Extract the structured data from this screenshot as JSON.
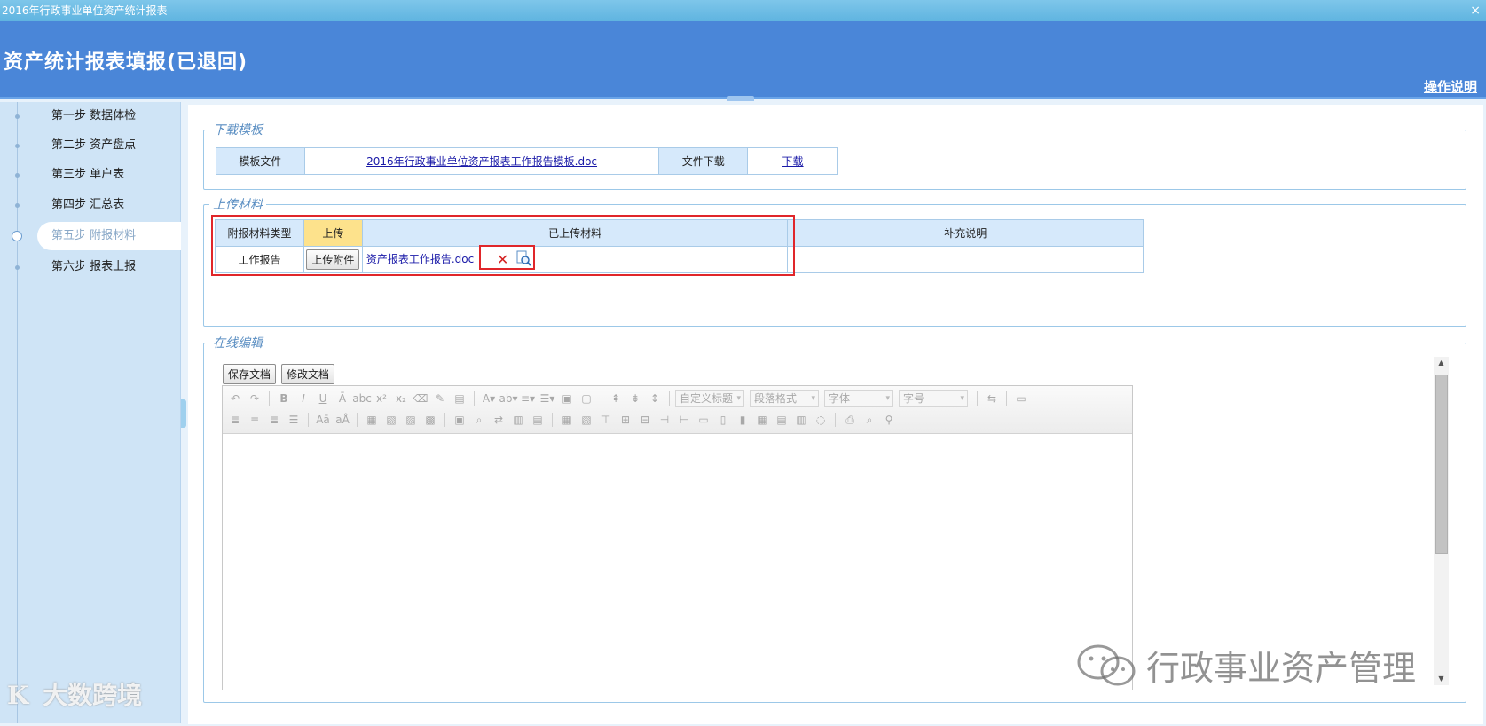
{
  "window": {
    "title": "2016年行政事业单位资产统计报表",
    "close_glyph": "×"
  },
  "header": {
    "title": "资产统计报表填报(已退回)",
    "help": "操作说明"
  },
  "sidebar": {
    "steps": [
      {
        "label": "第一步 数据体检"
      },
      {
        "label": "第二步 资产盘点"
      },
      {
        "label": "第三步 单户表"
      },
      {
        "label": "第四步 汇总表"
      },
      {
        "label": "第五步 附报材料"
      },
      {
        "label": "第六步 报表上报"
      }
    ],
    "active_step": 4
  },
  "download": {
    "legend": "下载模板",
    "template_label": "模板文件",
    "template_file": "2016年行政事业单位资产报表工作报告模板.doc",
    "file_download_label": "文件下载",
    "download_link": "下载"
  },
  "upload": {
    "legend": "上传材料",
    "headers": {
      "type": "附报材料类型",
      "upload": "上传",
      "uploaded": "已上传材料",
      "note": "补充说明"
    },
    "rows": [
      {
        "type": "工作报告",
        "upload_button": "上传附件",
        "file": "资产报表工作报告.doc",
        "note": ""
      }
    ],
    "icons": {
      "delete": "delete-icon",
      "preview": "preview-icon"
    }
  },
  "online_edit": {
    "legend": "在线编辑",
    "save_button": "保存文档",
    "modify_button": "修改文档",
    "toolbar": {
      "custom_heading": "自定义标题",
      "paragraph_format": "段落格式",
      "font": "字体",
      "font_size": "字号"
    }
  },
  "watermarks": {
    "brand": "大数跨境",
    "brand_mark": "K",
    "account": "行政事业资产管理"
  },
  "colors": {
    "header_blue": "#4a86d8",
    "sidebar": "#cfe4f6",
    "table_header": "#d6e9fb",
    "upload_header": "#fde28c",
    "highlight_red": "#e0262a"
  }
}
